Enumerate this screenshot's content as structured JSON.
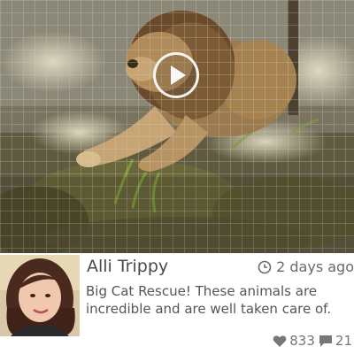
{
  "video": {
    "subject": "lion behind fence",
    "play_icon": "play-icon"
  },
  "post": {
    "avatar_icon": "avatar",
    "username": "Alli Trippy",
    "timestamp": "2 days ago",
    "comment": "Big Cat Rescue! These animals are incredible and are well taken care of.",
    "likes": "833",
    "comments": "21",
    "icons": {
      "time": "clock-icon",
      "likes": "heart-icon",
      "comments": "comment-icon"
    }
  },
  "colors": {
    "text_primary": "#4a4a4a",
    "text_secondary": "#6a6a6a",
    "icon_gray": "#777777"
  }
}
